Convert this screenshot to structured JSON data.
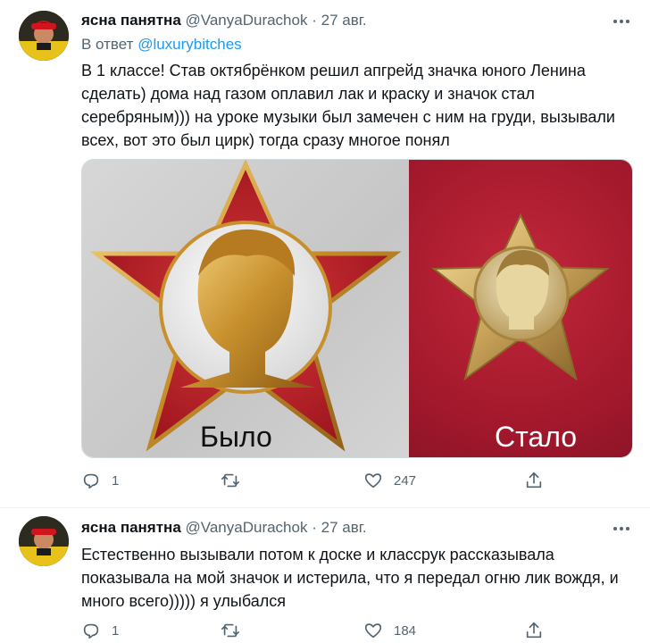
{
  "tweets": [
    {
      "author_name": "ясна панятна",
      "author_handle": "@VanyaDurachok",
      "separator": "·",
      "date": "27 авг.",
      "reply_prefix": "В ответ",
      "reply_handle": "@luxurybitches",
      "text": "В 1 классе! Став октябрёнком решил апгрейд значка юного Ленина сделать) дома над газом оплавил лак и краску и значок стал серебряным))) на уроке музыки был замечен с ним на груди, вызывали всех, вот это был цирк) тогда сразу многое понял",
      "media_caption_left": "Было",
      "media_caption_right": "Стало",
      "replies": "1",
      "retweets": "",
      "likes": "247"
    },
    {
      "author_name": "ясна панятна",
      "author_handle": "@VanyaDurachok",
      "separator": "·",
      "date": "27 авг.",
      "text": "Естественно вызывали потом к доске и классрук рассказывала показывала на мой значок и истерила, что я передал огню лик вождя, и много всего))))) я улыбался",
      "replies": "1",
      "retweets": "",
      "likes": "184"
    }
  ],
  "icons": {
    "reply": "reply-icon",
    "retweet": "retweet-icon",
    "like": "heart-icon",
    "share": "share-icon",
    "more": "more-icon"
  },
  "colors": {
    "link": "#1d9bf0",
    "secondary": "#536471",
    "text": "#0f1419",
    "badge_red": "#b3202e",
    "badge_gold": "#d9a94a"
  }
}
